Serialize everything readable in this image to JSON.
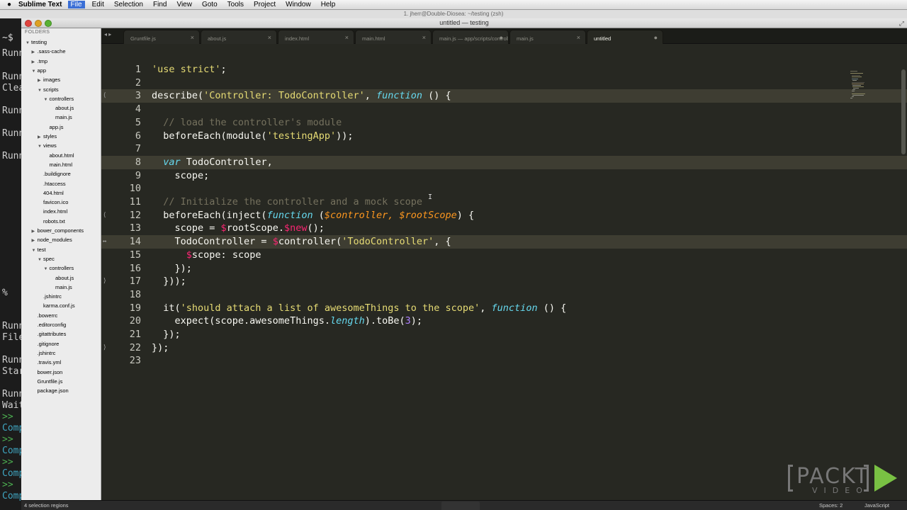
{
  "menubar": {
    "apple": "",
    "app_name": "Sublime Text",
    "items": [
      "File",
      "Edit",
      "Selection",
      "Find",
      "View",
      "Goto",
      "Tools",
      "Project",
      "Window",
      "Help"
    ]
  },
  "behind_window_title": "1. jherr@Double-Diosea: ~/testing (zsh)",
  "window": {
    "title": "untitled — testing"
  },
  "sidebar": {
    "header": "FOLDERS",
    "tree": [
      {
        "label": "testing",
        "depth": 0,
        "arrow": "▼"
      },
      {
        "label": ".sass-cache",
        "depth": 1,
        "arrow": "▶"
      },
      {
        "label": ".tmp",
        "depth": 1,
        "arrow": "▶"
      },
      {
        "label": "app",
        "depth": 1,
        "arrow": "▼"
      },
      {
        "label": "images",
        "depth": 2,
        "arrow": "▶"
      },
      {
        "label": "scripts",
        "depth": 2,
        "arrow": "▼"
      },
      {
        "label": "controllers",
        "depth": 3,
        "arrow": "▼"
      },
      {
        "label": "about.js",
        "depth": 4,
        "arrow": ""
      },
      {
        "label": "main.js",
        "depth": 4,
        "arrow": ""
      },
      {
        "label": "app.js",
        "depth": 3,
        "arrow": ""
      },
      {
        "label": "styles",
        "depth": 2,
        "arrow": "▶"
      },
      {
        "label": "views",
        "depth": 2,
        "arrow": "▼"
      },
      {
        "label": "about.html",
        "depth": 3,
        "arrow": ""
      },
      {
        "label": "main.html",
        "depth": 3,
        "arrow": ""
      },
      {
        "label": ".buildignore",
        "depth": 2,
        "arrow": ""
      },
      {
        "label": ".htaccess",
        "depth": 2,
        "arrow": ""
      },
      {
        "label": "404.html",
        "depth": 2,
        "arrow": ""
      },
      {
        "label": "favicon.ico",
        "depth": 2,
        "arrow": ""
      },
      {
        "label": "index.html",
        "depth": 2,
        "arrow": ""
      },
      {
        "label": "robots.txt",
        "depth": 2,
        "arrow": ""
      },
      {
        "label": "bower_components",
        "depth": 1,
        "arrow": "▶"
      },
      {
        "label": "node_modules",
        "depth": 1,
        "arrow": "▶"
      },
      {
        "label": "test",
        "depth": 1,
        "arrow": "▼"
      },
      {
        "label": "spec",
        "depth": 2,
        "arrow": "▼"
      },
      {
        "label": "controllers",
        "depth": 3,
        "arrow": "▼"
      },
      {
        "label": "about.js",
        "depth": 4,
        "arrow": ""
      },
      {
        "label": "main.js",
        "depth": 4,
        "arrow": ""
      },
      {
        "label": ".jshintrc",
        "depth": 2,
        "arrow": ""
      },
      {
        "label": "karma.conf.js",
        "depth": 2,
        "arrow": ""
      },
      {
        "label": ".bowerrc",
        "depth": 1,
        "arrow": ""
      },
      {
        "label": ".editorconfig",
        "depth": 1,
        "arrow": ""
      },
      {
        "label": ".gitattributes",
        "depth": 1,
        "arrow": ""
      },
      {
        "label": ".gitignore",
        "depth": 1,
        "arrow": ""
      },
      {
        "label": ".jshintrc",
        "depth": 1,
        "arrow": ""
      },
      {
        "label": ".travis.yml",
        "depth": 1,
        "arrow": ""
      },
      {
        "label": "bower.json",
        "depth": 1,
        "arrow": ""
      },
      {
        "label": "Gruntfile.js",
        "depth": 1,
        "arrow": ""
      },
      {
        "label": "package.json",
        "depth": 1,
        "arrow": ""
      }
    ]
  },
  "tabbar": {
    "nav": "◂ ▸",
    "tabs": [
      {
        "label": "Gruntfile.js",
        "mark": "×",
        "active": false
      },
      {
        "label": "about.js",
        "mark": "×",
        "active": false
      },
      {
        "label": "index.html",
        "mark": "×",
        "active": false
      },
      {
        "label": "main.html",
        "mark": "×",
        "active": false
      },
      {
        "label": "main.js — app/scripts/controllers",
        "mark": "●",
        "active": false
      },
      {
        "label": "main.js",
        "mark": "×",
        "active": false
      },
      {
        "label": "untitled",
        "mark": "●",
        "active": true
      }
    ]
  },
  "editor": {
    "colors": {
      "plain": "#f8f8f2",
      "string": "#e6db74",
      "comment": "#75715e",
      "keyword": "#66d9ef",
      "param": "#fd971f",
      "special": "#f92672",
      "number": "#ae81ff",
      "function": "#a6e22e"
    },
    "lines": [
      {
        "n": "1",
        "tokens": [
          [
            "'use strict'",
            "string"
          ],
          [
            ";",
            "plain"
          ]
        ]
      },
      {
        "n": "2",
        "tokens": []
      },
      {
        "n": "3",
        "fold": "⟨",
        "hl": true,
        "tokens": [
          [
            "describe(",
            "plain"
          ],
          [
            "'Controller: TodoController'",
            "string"
          ],
          [
            ", ",
            "plain"
          ],
          [
            "function",
            "keyword"
          ],
          [
            " () {",
            "plain"
          ]
        ]
      },
      {
        "n": "4",
        "tokens": []
      },
      {
        "n": "5",
        "tokens": [
          [
            "  // load the controller's module",
            "comment"
          ]
        ]
      },
      {
        "n": "6",
        "tokens": [
          [
            "  beforeEach(module(",
            "plain"
          ],
          [
            "'testingApp'",
            "string"
          ],
          [
            "));",
            "plain"
          ]
        ]
      },
      {
        "n": "7",
        "tokens": []
      },
      {
        "n": "8",
        "hl": true,
        "tokens": [
          [
            "  ",
            "plain"
          ],
          [
            "var",
            "keyword"
          ],
          [
            " TodoController,",
            "plain"
          ]
        ]
      },
      {
        "n": "9",
        "tokens": [
          [
            "    scope;",
            "plain"
          ]
        ]
      },
      {
        "n": "10",
        "tokens": []
      },
      {
        "n": "11",
        "tokens": [
          [
            "  // Initialize the controller and a mock scope",
            "comment"
          ]
        ]
      },
      {
        "n": "12",
        "fold": "⟨",
        "tokens": [
          [
            "  beforeEach(inject(",
            "plain"
          ],
          [
            "function",
            "keyword"
          ],
          [
            " (",
            "plain"
          ],
          [
            "$controller, $rootScope",
            "param"
          ],
          [
            ") {",
            "plain"
          ]
        ]
      },
      {
        "n": "13",
        "tokens": [
          [
            "    scope = ",
            "plain"
          ],
          [
            "$",
            "special"
          ],
          [
            "rootScope.",
            "plain"
          ],
          [
            "$new",
            "special"
          ],
          [
            "();",
            "plain"
          ]
        ]
      },
      {
        "n": "14",
        "fold": "↔",
        "hl": true,
        "tokens": [
          [
            "    TodoController = ",
            "plain"
          ],
          [
            "$",
            "special"
          ],
          [
            "controller(",
            "plain"
          ],
          [
            "'TodoController'",
            "string"
          ],
          [
            ", {",
            "plain"
          ]
        ]
      },
      {
        "n": "15",
        "tokens": [
          [
            "      ",
            "plain"
          ],
          [
            "$",
            "special"
          ],
          [
            "scope: scope",
            "plain"
          ]
        ]
      },
      {
        "n": "16",
        "tokens": [
          [
            "    });",
            "plain"
          ]
        ]
      },
      {
        "n": "17",
        "fold": "⟩",
        "tokens": [
          [
            "  }));",
            "plain"
          ]
        ]
      },
      {
        "n": "18",
        "tokens": []
      },
      {
        "n": "19",
        "tokens": [
          [
            "  it(",
            "plain"
          ],
          [
            "'should attach a list of awesomeThings to the scope'",
            "string"
          ],
          [
            ", ",
            "plain"
          ],
          [
            "function",
            "keyword"
          ],
          [
            " () {",
            "plain"
          ]
        ]
      },
      {
        "n": "20",
        "tokens": [
          [
            "    expect(scope.awesomeThings.",
            "plain"
          ],
          [
            "length",
            "keyword"
          ],
          [
            ").toBe(",
            "plain"
          ],
          [
            "3",
            "number"
          ],
          [
            ");",
            "plain"
          ]
        ]
      },
      {
        "n": "21",
        "tokens": [
          [
            "  });",
            "plain"
          ]
        ]
      },
      {
        "n": "22",
        "fold": "⟩",
        "tokens": [
          [
            "});",
            "plain"
          ]
        ]
      },
      {
        "n": "23",
        "tokens": []
      }
    ]
  },
  "terminal_fragments": [
    {
      "text": "~$",
      "color": "#dddddd"
    },
    {
      "text": "Runn",
      "color": "#cfcfcf"
    },
    {
      "text": "Runn",
      "color": "#cfcfcf"
    },
    {
      "text": "Clea",
      "color": "#cfcfcf"
    },
    {
      "text": "Runn",
      "color": "#cfcfcf"
    },
    {
      "text": "Runn",
      "color": "#cfcfcf"
    },
    {
      "text": "Runn",
      "color": "#cfcfcf"
    },
    {
      "text": "%",
      "color": "#cfcfcf"
    },
    {
      "text": "Runn",
      "color": "#cfcfcf"
    },
    {
      "text": "File",
      "color": "#cfcfcf"
    },
    {
      "text": "Runn",
      "color": "#cfcfcf"
    },
    {
      "text": "Star",
      "color": "#cfcfcf"
    },
    {
      "text": "Runn",
      "color": "#cfcfcf"
    },
    {
      "text": "Wait",
      "color": "#cfcfcf"
    },
    {
      "text": ">>",
      "color": "#4caf50"
    },
    {
      "text": "Comp",
      "color": "#3fa5c0"
    },
    {
      "text": ">>",
      "color": "#4caf50"
    },
    {
      "text": "Comp",
      "color": "#3fa5c0"
    },
    {
      "text": ">>",
      "color": "#4caf50"
    },
    {
      "text": "Comp",
      "color": "#3fa5c0"
    },
    {
      "text": ">>",
      "color": "#4caf50"
    },
    {
      "text": "Comp",
      "color": "#3fa5c0"
    }
  ],
  "statusbar": {
    "left": "4 selection regions",
    "spaces": "Spaces: 2",
    "syntax": "JavaScript"
  },
  "watermark": {
    "word": "PACKT",
    "sub": "VIDEO",
    "arrow_color": "#79c143"
  }
}
